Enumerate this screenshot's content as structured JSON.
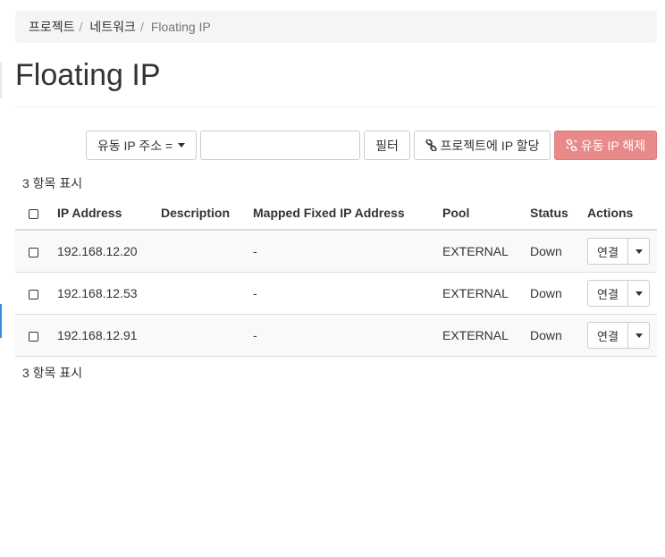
{
  "breadcrumb": {
    "items": [
      "프로젝트",
      "네트워크"
    ],
    "separator": "/",
    "current": "Floating IP"
  },
  "page": {
    "title": "Floating IP"
  },
  "toolbar": {
    "filter_field_label": "유동 IP 주소 =",
    "filter_input_value": "",
    "filter_button": "필터",
    "allocate_button": "프로젝트에 IP 할당",
    "release_button": "유동 IP 해제",
    "release_color": "#e8898a"
  },
  "summary": {
    "top": "3 항목 표시",
    "bottom": "3 항목 표시"
  },
  "table": {
    "headers": {
      "ip": "IP Address",
      "description": "Description",
      "mapped": "Mapped Fixed IP Address",
      "pool": "Pool",
      "status": "Status",
      "actions": "Actions"
    },
    "rows": [
      {
        "ip": "192.168.12.20",
        "description": "",
        "mapped": "-",
        "pool": "EXTERNAL",
        "status": "Down",
        "action": "연결"
      },
      {
        "ip": "192.168.12.53",
        "description": "",
        "mapped": "-",
        "pool": "EXTERNAL",
        "status": "Down",
        "action": "연결"
      },
      {
        "ip": "192.168.12.91",
        "description": "",
        "mapped": "-",
        "pool": "EXTERNAL",
        "status": "Down",
        "action": "연결"
      }
    ]
  },
  "icons": {
    "allocate": "link-icon",
    "release": "unlink-icon",
    "dropdown": "caret-down-icon"
  }
}
